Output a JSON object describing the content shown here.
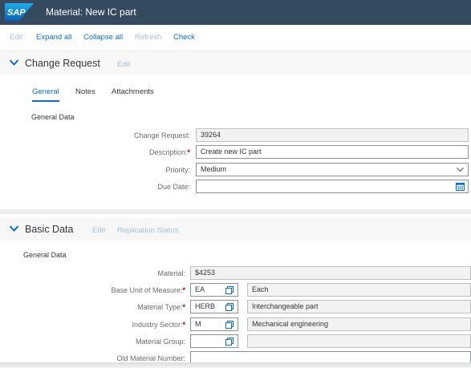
{
  "shell": {
    "logo_text": "SAP",
    "title": "Material: New IC part"
  },
  "toolbar": {
    "edit": "Edit",
    "expand_all": "Expand all",
    "collapse_all": "Collapse all",
    "refresh": "Refresh",
    "check": "Check"
  },
  "change_request_section": {
    "title": "Change Request",
    "edit": "Edit",
    "tabs": {
      "general": "General",
      "notes": "Notes",
      "attachments": "Attachments"
    },
    "group_title": "General Data",
    "change_request": {
      "label": "Change Request:",
      "value": "39264"
    },
    "description": {
      "label": "Description:",
      "value": "Create new IC part"
    },
    "priority": {
      "label": "Priority:",
      "value": "Medium"
    },
    "due_date": {
      "label": "Due Date:",
      "value": ""
    }
  },
  "basic_data_section": {
    "title": "Basic Data",
    "edit": "Edit",
    "replication_status": "Replication Status",
    "group_title": "General Data",
    "material": {
      "label": "Material:",
      "value": "$4253"
    },
    "base_unit": {
      "label": "Base Unit of Measure:",
      "code": "EA",
      "text": "Each"
    },
    "material_type": {
      "label": "Material Type:",
      "code": "HERB",
      "text": "Interchangeable part"
    },
    "industry_sector": {
      "label": "Industry Sector:",
      "code": "M",
      "text": "Mechanical engineering"
    },
    "material_group": {
      "label": "Material Group:",
      "code": "",
      "text": ""
    },
    "old_material_number": {
      "label": "Old Material Number:",
      "value": ""
    }
  },
  "colors": {
    "shell_bg": "#354a5f",
    "link_blue": "#0a6ed1",
    "disabled_link": "#a7bfd9",
    "required_star": "#bb0000"
  },
  "required_marker": "*"
}
